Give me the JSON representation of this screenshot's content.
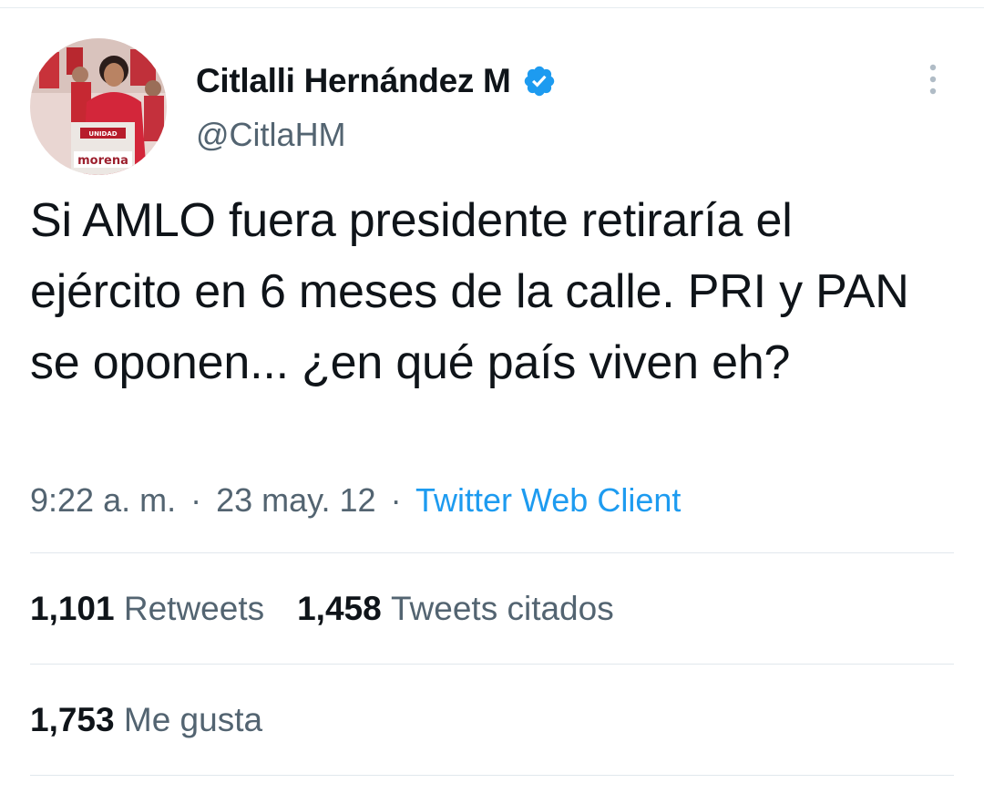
{
  "tweet": {
    "author": {
      "display_name": "Citlalli Hernández M",
      "handle": "@CitlaHM",
      "verified": true
    },
    "text": "Si AMLO fuera presidente retiraría el ejército en 6 meses de la calle. PRI y PAN se oponen... ¿en qué país viven eh?",
    "time": "9:22 a. m.",
    "date": "23 may. 12",
    "separator": "·",
    "client": "Twitter Web Client",
    "stats": {
      "retweets_count": "1,101",
      "retweets_label": "Retweets",
      "quotes_count": "1,458",
      "quotes_label": "Tweets citados",
      "likes_count": "1,753",
      "likes_label": "Me gusta"
    },
    "avatar_sign_text": {
      "line1": "UNIDAD",
      "line2": "morena"
    }
  },
  "colors": {
    "text": "#0f1419",
    "secondary": "#536471",
    "accent": "#1d9bf0",
    "verified": "#1d9bf0",
    "divider": "#e1e8ed"
  },
  "icons": {
    "verified": "verified-badge-icon",
    "more": "more-vertical-icon"
  }
}
